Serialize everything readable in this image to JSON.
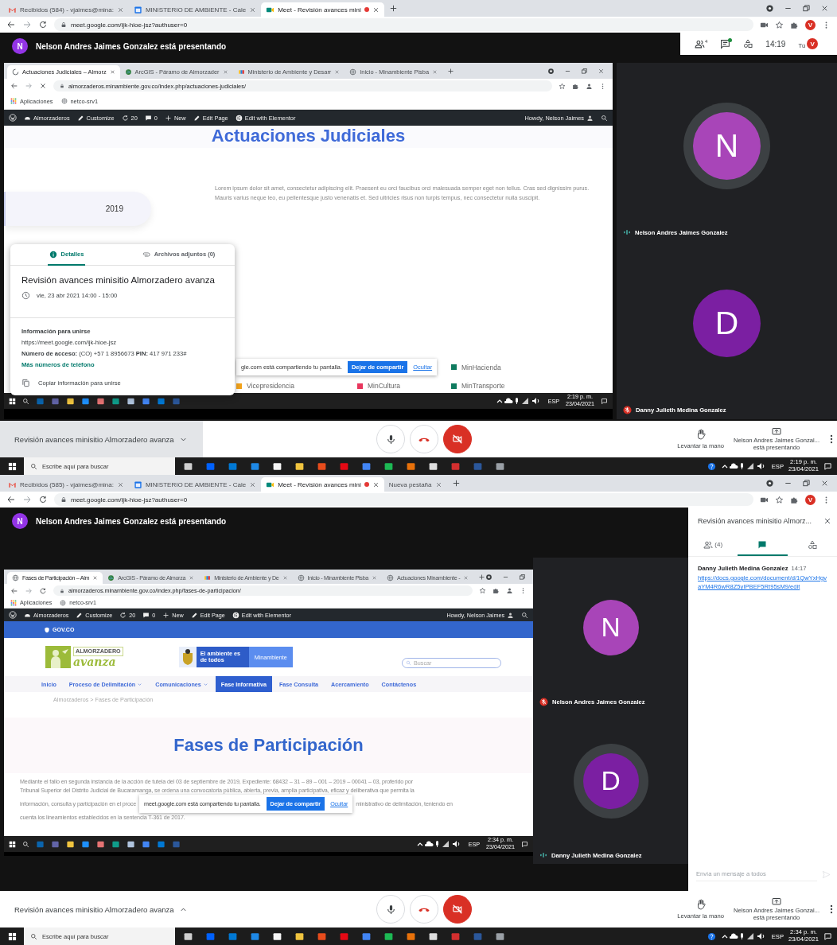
{
  "screens": [
    {
      "browser": {
        "tabs": [
          {
            "label": "Recibidos (584) - vjaimes@mina:",
            "kind": "mail",
            "selected": false,
            "recording": false
          },
          {
            "label": "MINISTERIO DE AMBIENTE - Cale",
            "kind": "calendar",
            "selected": false,
            "recording": false
          },
          {
            "label": "Meet - Revisión avances mini",
            "kind": "meet",
            "selected": true,
            "recording": true
          }
        ],
        "address": "meet.google.com/ijk-hioe-jsz?authuser=0",
        "loading": false,
        "profile": "V"
      },
      "banner": {
        "avatar": "N",
        "text": "Nelson Andres Jaimes Gonzalez está presentando"
      },
      "top_bar": {
        "people_count": "4",
        "chat_unread": true,
        "time": "14:19",
        "you": "Tú",
        "profile": "V"
      },
      "shared": {
        "browser": {
          "tabs": [
            {
              "label": "Actuaciones Judiciales – Almorz",
              "kind": "loading",
              "selected": true
            },
            {
              "label": "ArcGIS - Páramo de Almorzader",
              "kind": "arcgis",
              "selected": false
            },
            {
              "label": "Ministerio de Ambiente y Desarr",
              "kind": "ministry",
              "selected": false
            },
            {
              "label": "Inicio - Minambiente Pisba",
              "kind": "globe",
              "selected": false
            }
          ],
          "address": "almorzaderos.minambiente.gov.co/index.php/actuaciones-judiciales/",
          "loading": true,
          "bookmarks": [
            "Aplicaciones",
            "netco-srv1"
          ]
        },
        "admin_bar": {
          "site": "Almorzaderos",
          "customize": "Customize",
          "updates": "20",
          "comments": "0",
          "new": "New",
          "edit": "Edit Page",
          "elementor": "Edit with Elementor",
          "howdy": "Howdy, Nelson Jaimes"
        },
        "page": {
          "kind": "judicial",
          "heading": "Actuaciones Judiciales",
          "year": "2019",
          "text": "Lorem ipsum dolor sit amet, consectetur adipiscing elit. Praesent eu orci faucibus orci malesuada semper eget non tellus. Cras sed dignissim purus. Mauris varius neque leo, eu pellentesque justo venenatis et. Sed ultricies risus non turpis tempus, nec consectetur nulla suscipit.",
          "legend": [
            {
              "label": "MinHacienda",
              "color": "#0f7b5f"
            },
            {
              "label": "Vicepresidencia",
              "color": "#f4a41c"
            },
            {
              "label": "MinCultura",
              "color": "#e8365d"
            },
            {
              "label": "MinTransporte",
              "color": "#0f7b5f"
            }
          ]
        },
        "share_notice": {
          "text": "gle.com está compartiendo tu pantalla.",
          "stop": "Dejar de compartir",
          "hide": "Ocultar"
        },
        "taskbar": {
          "language": "ESP",
          "time": "2:19 p. m.",
          "date": "23/04/2021"
        }
      },
      "details_card": {
        "tabs": [
          {
            "label": "Detalles",
            "kind": "info",
            "selected": true
          },
          {
            "label": "Archivos adjuntos (0)",
            "kind": "attachment",
            "selected": false
          }
        ],
        "title": "Revisión avances minisitio Almorzadero avanza",
        "when": "vie, 23 abr 2021 14:00 - 15:00",
        "join_heading": "Información para unirse",
        "link": "https://meet.google.com/ijk-hioe-jsz",
        "phone": "**Número de acceso:** (CO) +57 1 8956673  **PIN:** 417 971 233#",
        "more_phones": "Más números de teléfono",
        "copy": "Copiar información para unirse"
      },
      "tiles": [
        {
          "avatar": "N",
          "color": "#a845b8",
          "name": "Nelson Andres Jaimes Gonzalez",
          "speaking": true,
          "muted": false
        },
        {
          "avatar": "D",
          "color": "#7b1fa2",
          "name": "Danny Julieth Medina Gonzalez",
          "speaking": false,
          "muted": true
        }
      ],
      "controls": {
        "meeting_title": "Revisión avances minisitio Almorzadero avanza",
        "details_open": true,
        "mic_on": true,
        "camera_on": false,
        "raise_hand": "Levantar la mano",
        "presenter": "Nelson Andres Jaimes Gonzal...",
        "presenter_status": "está presentando"
      },
      "taskbar": {
        "search_placeholder": "Escribe aquí para buscar",
        "language": "ESP",
        "time": "2:19 p. m.",
        "date": "23/04/2021"
      }
    },
    {
      "browser": {
        "tabs": [
          {
            "label": "Recibidos (585) - vjaimes@mina:",
            "kind": "mail",
            "selected": false,
            "recording": false
          },
          {
            "label": "MINISTERIO DE AMBIENTE - Cale",
            "kind": "calendar",
            "selected": false,
            "recording": false
          },
          {
            "label": "Meet - Revisión avances mini",
            "kind": "meet",
            "selected": true,
            "recording": true
          },
          {
            "label": "Nueva pestaña",
            "kind": "blank",
            "selected": false,
            "recording": false
          }
        ],
        "address": "meet.google.com/ijk-hioe-jsz?authuser=0",
        "loading": false,
        "profile": "V"
      },
      "banner": {
        "avatar": "N",
        "text": "Nelson Andres Jaimes Gonzalez está presentando"
      },
      "shared": {
        "browser": {
          "tabs": [
            {
              "label": "Fases de Participación – Alm",
              "kind": "globe",
              "selected": true
            },
            {
              "label": "ArcGIS - Páramo de Almorza",
              "kind": "arcgis",
              "selected": false
            },
            {
              "label": "Ministerio de Ambiente y De",
              "kind": "ministry",
              "selected": false
            },
            {
              "label": "Inicio - Minambiente Pisba",
              "kind": "globe",
              "selected": false
            },
            {
              "label": "Actuaciones Minambiente -",
              "kind": "globe",
              "selected": false
            }
          ],
          "address": "almorzaderos.minambiente.gov.co/index.php/fases-de-participacion/",
          "loading": false,
          "bookmarks": [
            "Aplicaciones",
            "netco-srv1"
          ]
        },
        "admin_bar": {
          "site": "Almorzaderos",
          "customize": "Customize",
          "updates": "20",
          "comments": "0",
          "new": "New",
          "edit": "Edit Page",
          "elementor": "Edit with Elementor",
          "howdy": "Howdy, Nelson Jaimes"
        },
        "page": {
          "kind": "phases",
          "gov": "GOV.CO",
          "logo_top": "ALMORZADERO",
          "logo_bottom": "avanza",
          "slogan": "El ambiente es de todos",
          "ministry": "Minambiente",
          "search_placeholder": "Buscar",
          "nav": [
            {
              "label": "Inicio",
              "dropdown": false,
              "selected": false
            },
            {
              "label": "Proceso de Delimitación",
              "dropdown": true,
              "selected": false
            },
            {
              "label": "Comunicaciones",
              "dropdown": true,
              "selected": false
            },
            {
              "label": "Fase Informativa",
              "dropdown": false,
              "selected": true
            },
            {
              "label": "Fase Consulta",
              "dropdown": false,
              "selected": false
            },
            {
              "label": "Acercamiento",
              "dropdown": false,
              "selected": false
            },
            {
              "label": "Contáctenos",
              "dropdown": false,
              "selected": false
            }
          ],
          "breadcrumb": "Almorzaderos > Fases de Participación",
          "heading": "Fases de Participación",
          "paragraph_top": [
            "Mediante el fallo en segunda instancia de la acción de tutela del 03 de septiembre de 2019, Expediente: 68432 – 31 – 89 – 001 – 2019 – 00041 – 03, proferido por",
            "Tribunal Superior del Distrito Judicial de Bucaramanga, se ordena una convocatoria pública, abierta, previa, amplia participativa, eficaz y deliberativa que permita la"
          ],
          "paragraph_split": [
            "información, consulta y participación en el proce",
            "ministrativo de delimitación, teniendo en"
          ],
          "paragraph_bottom": [
            "cuenta los lineamientos establecidos en la sentencia T-361 de 2017."
          ]
        },
        "share_notice": {
          "text": "meet.google.com está compartiendo tu pantalla.",
          "stop": "Dejar de compartir",
          "hide": "Ocultar"
        },
        "taskbar": {
          "language": "ESP",
          "time": "2:34 p. m.",
          "date": "23/04/2021"
        }
      },
      "tiles": [
        {
          "avatar": "N",
          "color": "#a845b8",
          "name": "Nelson Andres Jaimes Gonzalez",
          "speaking": false,
          "muted": true
        },
        {
          "avatar": "D",
          "color": "#7b1fa2",
          "name": "Danny Julieth Medina Gonzalez",
          "speaking": true,
          "muted": false
        }
      ],
      "chat_panel": {
        "title": "Revisión avances minisitio Almorz...",
        "tabs": [
          {
            "kind": "people",
            "label": "(4)",
            "selected": false
          },
          {
            "kind": "chat",
            "selected": true
          },
          {
            "kind": "activities",
            "selected": false
          }
        ],
        "messages": [
          {
            "sender": "Danny Julieth Medina Gonzalez",
            "time": "14:17",
            "text": "https://docs.google.com/document/d/1QwYxHgvaYM4R6wR8Z5yIPBEF5Rt95sM9/edit"
          }
        ],
        "placeholder": "Envía un mensaje a todos"
      },
      "controls": {
        "meeting_title": "Revisión avances minisitio Almorzadero avanza",
        "details_open": false,
        "mic_on": true,
        "camera_on": false,
        "raise_hand": "Levantar la mano",
        "presenter": "Nelson Andres Jaimes Gonzal...",
        "presenter_status": "está presentando"
      },
      "taskbar": {
        "search_placeholder": "Escribe aquí para buscar",
        "language": "ESP",
        "time": "2:34 p. m.",
        "date": "23/04/2021"
      }
    }
  ]
}
